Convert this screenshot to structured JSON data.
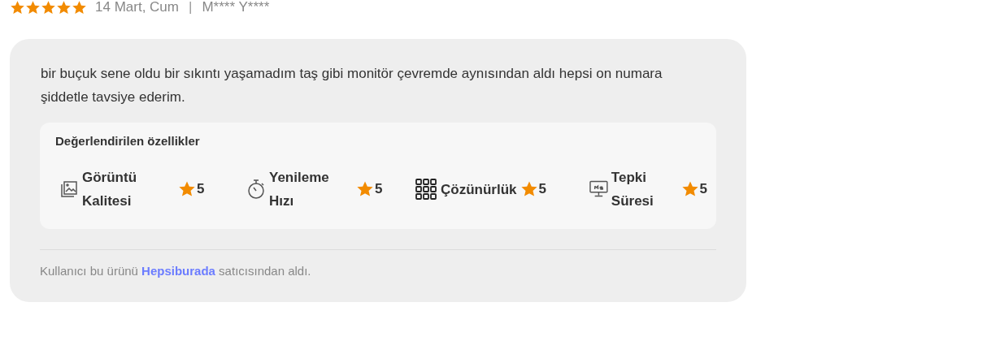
{
  "review": {
    "stars": 5,
    "date": "14 Mart, Cum",
    "separator": "|",
    "author": "M**** Y****",
    "text": "bir buçuk sene oldu bir sıkıntı yaşamadım taş gibi monitör çevremde aynısından aldı hepsi on numara şiddetle tavsiye ederim.",
    "features": {
      "title": "Değerlendirilen özellikler",
      "items": [
        {
          "kind": "picture",
          "label": "Görüntü Kalitesi",
          "rating": "5"
        },
        {
          "kind": "timer",
          "label": "Yenileme Hızı",
          "rating": "5"
        },
        {
          "kind": "grid",
          "label": "Çözünürlük",
          "rating": "5"
        },
        {
          "kind": "monitor",
          "label": "Tepki Süresi",
          "rating": "5"
        }
      ]
    },
    "footer": {
      "before": "Kullanıcı bu ürünü",
      "seller": "Hepsiburada",
      "after": "satıcısından aldı."
    }
  }
}
